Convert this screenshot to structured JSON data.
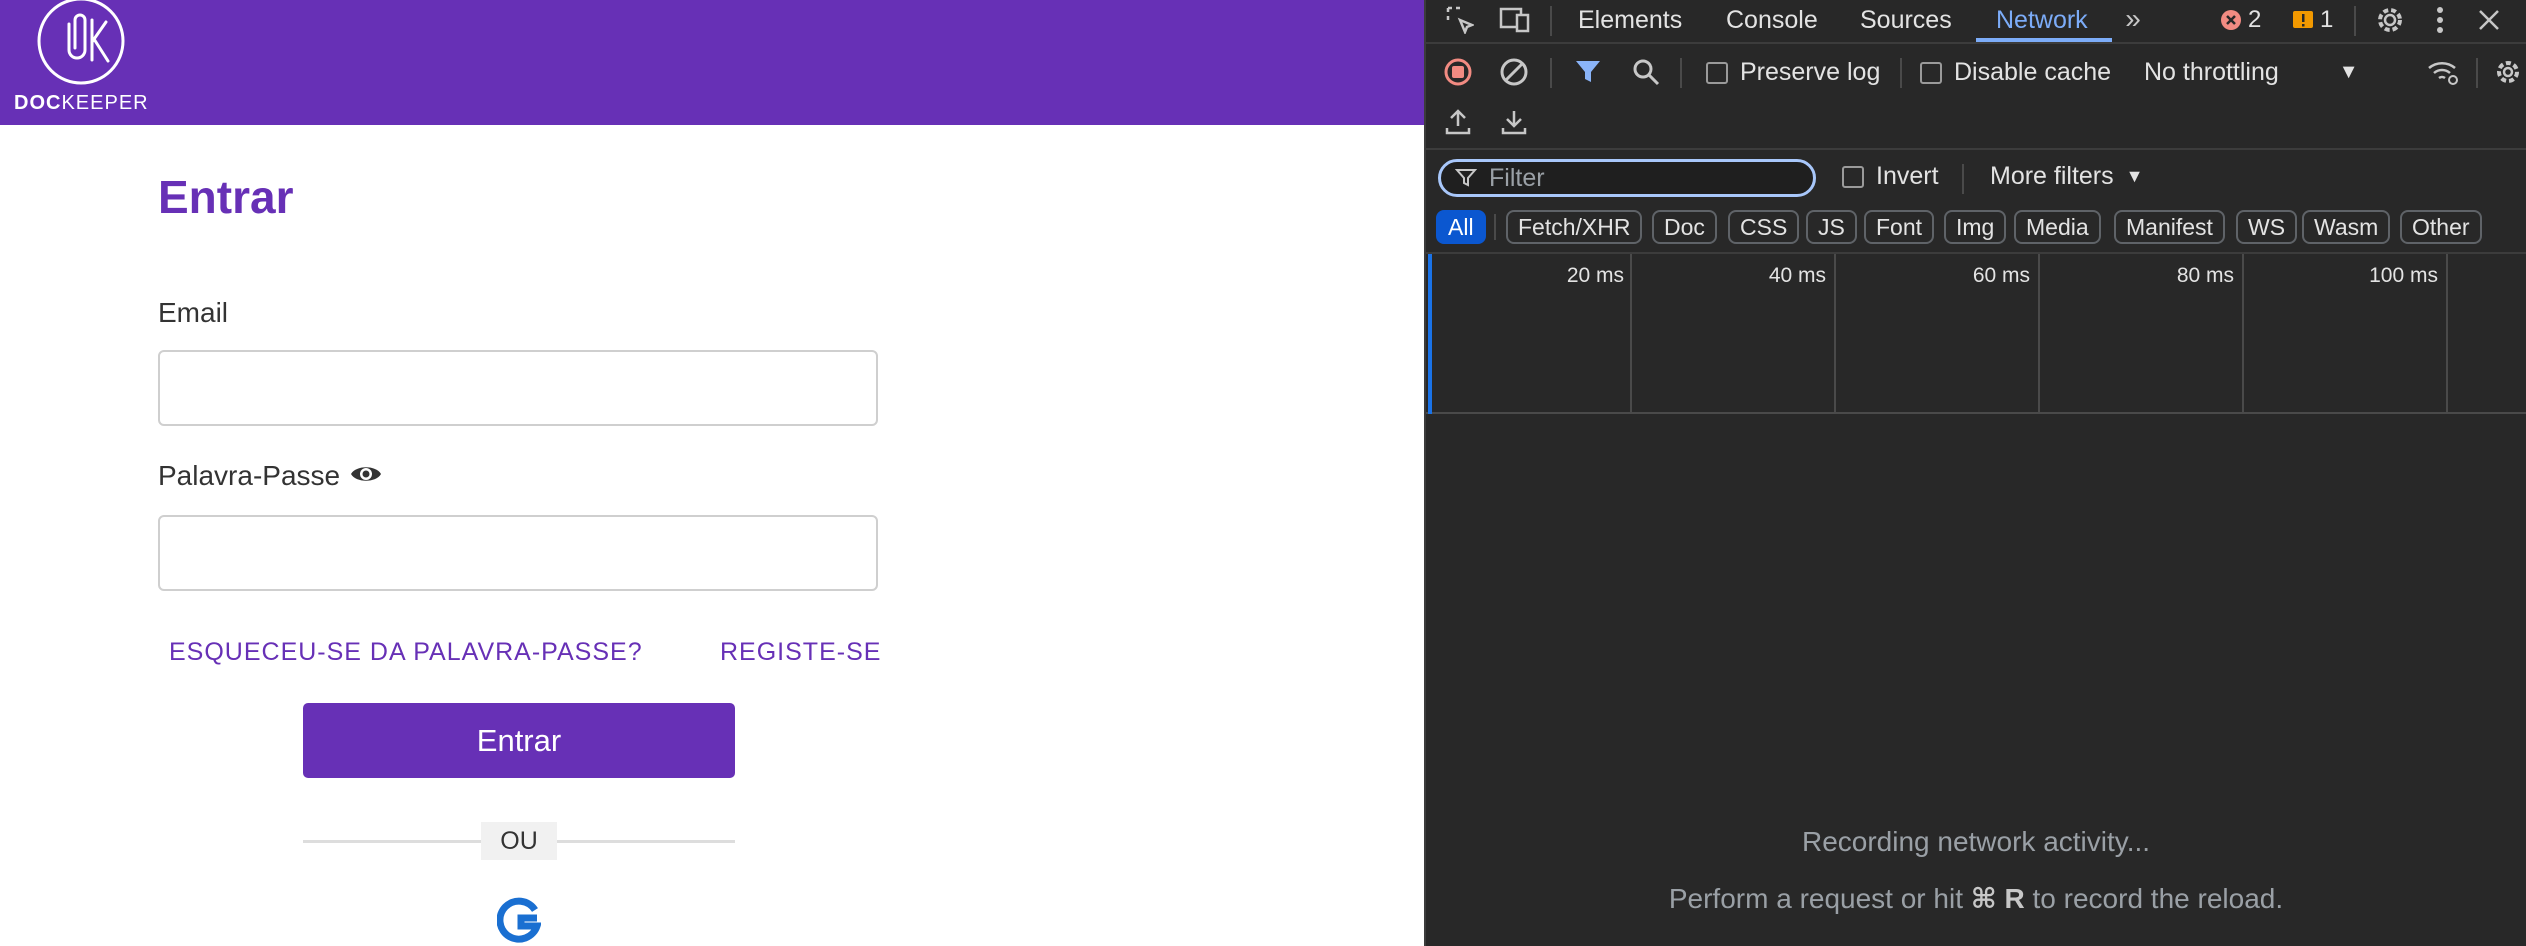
{
  "app": {
    "logo": {
      "brand_bold": "DOC",
      "brand_rest": "KEEPER",
      "mark": "OK"
    },
    "login": {
      "title": "Entrar",
      "email_label": "Email",
      "password_label": "Palavra-Passe",
      "email_value": "",
      "password_value": "",
      "forgot_link": "ESQUECEU-SE DA PALAVRA-PASSE?",
      "register_link": "REGISTE-SE",
      "submit_label": "Entrar",
      "divider_text": "OU",
      "google_icon": "google-g-icon"
    },
    "colors": {
      "brand": "#6730b6",
      "google_blue": "#1a6fd1"
    }
  },
  "devtools": {
    "tabs": [
      {
        "label": "Elements",
        "active": false
      },
      {
        "label": "Console",
        "active": false
      },
      {
        "label": "Sources",
        "active": false
      },
      {
        "label": "Network",
        "active": true
      }
    ],
    "error_count": "2",
    "warning_count": "1",
    "preserve_log_label": "Preserve log",
    "disable_cache_label": "Disable cache",
    "throttling_value": "No throttling",
    "filter_placeholder": "Filter",
    "invert_label": "Invert",
    "more_filters_label": "More filters",
    "type_filters": [
      "All",
      "Fetch/XHR",
      "Doc",
      "CSS",
      "JS",
      "Font",
      "Img",
      "Media",
      "Manifest",
      "WS",
      "Wasm",
      "Other"
    ],
    "active_type_filter": "All",
    "timeline_ticks": [
      "20 ms",
      "40 ms",
      "60 ms",
      "80 ms",
      "100 ms"
    ],
    "empty_message": "Recording network activity...",
    "empty_hint_prefix": "Perform a request or hit",
    "empty_hint_shortcut": "⌘ R",
    "empty_hint_suffix": "to record the reload.",
    "colors": {
      "accent": "#7cacf8",
      "record_red": "#f28b82",
      "filter_blue": "#8ab4f8",
      "error": "#f28b82",
      "warning": "#f29900"
    }
  }
}
